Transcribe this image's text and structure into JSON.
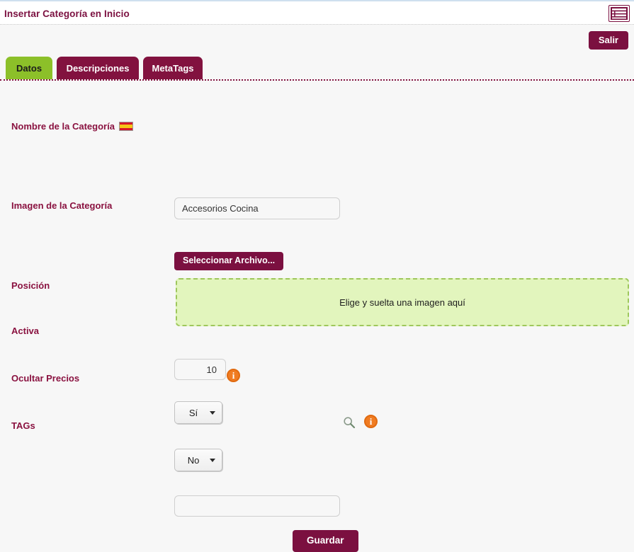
{
  "colors": {
    "brand_maroon": "#7b1040",
    "tab_active_green": "#8cc029",
    "tab_inactive_maroon": "#82123f",
    "label_maroon": "#8a1240",
    "dropzone_fill": "#e2f5bd",
    "dropzone_border": "#9ec75c",
    "info_orange": "#f07c22",
    "page_bg": "#f7f7f7"
  },
  "header": {
    "title": "Insertar Categoría en Inicio",
    "list_icon_name": "list-view-icon"
  },
  "toolbar": {
    "exit_label": "Salir"
  },
  "tabs": [
    {
      "label": "Datos",
      "active": true
    },
    {
      "label": "Descripciones",
      "active": false
    },
    {
      "label": "MetaTags",
      "active": false
    }
  ],
  "form": {
    "nombre": {
      "label": "Nombre de la Categoría",
      "flag_icon": "spain-flag-icon",
      "value": "Accesorios Cocina",
      "placeholder": ""
    },
    "imagen": {
      "label": "Imagen de la Categoría",
      "file_button_label": "Seleccionar Archivo...",
      "dropzone_text": "Elige y suelta una imagen aquí"
    },
    "posicion": {
      "label": "Posición",
      "value": "10",
      "placeholder": ""
    },
    "activa": {
      "label": "Activa",
      "value": "Sí",
      "options": [
        "Sí",
        "No"
      ]
    },
    "ocultar_precios": {
      "label": "Ocultar Precios",
      "value": "No",
      "options": [
        "Sí",
        "No"
      ],
      "info_icon": "info-icon"
    },
    "tags": {
      "label": "TAGs",
      "value": "",
      "placeholder": "",
      "search_icon": "search-icon",
      "info_icon": "info-icon"
    }
  },
  "actions": {
    "save_label": "Guardar"
  }
}
